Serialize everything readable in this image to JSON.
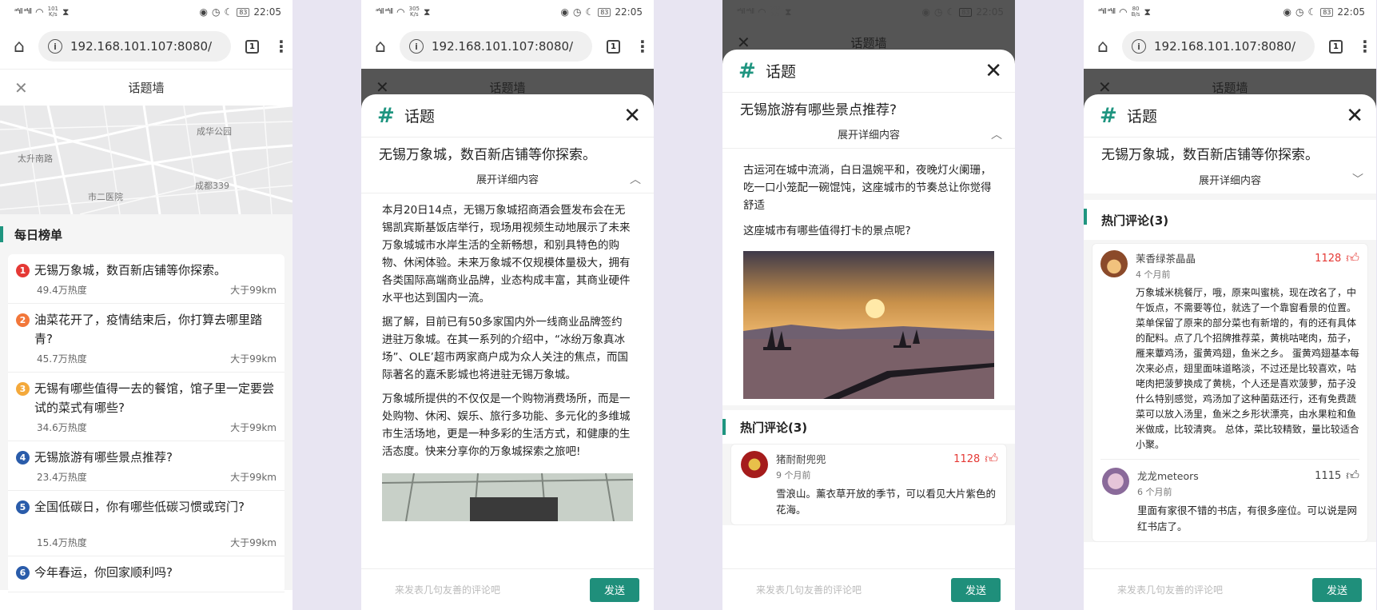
{
  "statusbar": {
    "signal": "ᵃ⁴ıll ᵃ⁴ıll",
    "time": "22:05",
    "battery": "83",
    "speeds": [
      "101\nK/s",
      "305\nK/s",
      "282\nK/s",
      "80\nB/s"
    ]
  },
  "browser": {
    "url": "192.168.101.107:8080/",
    "tab_count": "1"
  },
  "page_title": "话题墙",
  "map": {
    "labels": [
      "成华公园",
      "太升南路",
      "成都339",
      "市二医院"
    ]
  },
  "daily": {
    "title": "每日榜单",
    "items": [
      {
        "num": "1",
        "color": "#e53935",
        "title": "无锡万象城，数百新店铺等你探索。",
        "heat": "49.4万热度",
        "dist": "大于99km"
      },
      {
        "num": "2",
        "color": "#f2773a",
        "title": "油菜花开了，疫情结束后，你打算去哪里踏青?",
        "heat": "45.7万热度",
        "dist": "大于99km"
      },
      {
        "num": "3",
        "color": "#f4a93b",
        "title": "无锡有哪些值得一去的餐馆，馆子里一定要尝试的菜式有哪些?",
        "heat": "34.6万热度",
        "dist": "大于99km"
      },
      {
        "num": "4",
        "color": "#2a5caa",
        "title": "无锡旅游有哪些景点推荐?",
        "heat": "23.4万热度",
        "dist": "大于99km"
      },
      {
        "num": "5",
        "color": "#2a5caa",
        "title": "全国低碳日，你有哪些低碳习惯或窍门?",
        "heat": "15.4万热度",
        "dist": "大于99km"
      },
      {
        "num": "6",
        "color": "#2a5caa",
        "title": "今年春运，你回家顺利吗?",
        "heat": "",
        "dist": ""
      }
    ]
  },
  "sheet": {
    "title": "话题",
    "expand_label": "展开详细内容",
    "topic1": "无锡万象城，数百新店铺等你探索。",
    "topic2": "无锡旅游有哪些景点推荐?",
    "detail1": [
      "本月20日14点，无锡万象城招商酒会暨发布会在无锡凯宾斯基饭店举行，现场用视频生动地展示了未来万象城城市水岸生活的全新畅想，和别具特色的购物、休闲体验。未来万象城不仅规模体量极大，拥有各类国际高端商业品牌，业态构成丰富，其商业硬件水平也达到国内一流。",
      "据了解，目前已有50多家国内外一线商业品牌签约进驻万象城。在其一系列的介绍中，“冰纷万象真冰场”、OLE’超市两家商户成为众人关注的焦点，而国际著名的嘉禾影城也将进驻无锡万象城。",
      "万象城所提供的不仅仅是一个购物消费场所，而是一处购物、休闲、娱乐、旅行多功能、多元化的多维城市生活场地，更是一种多彩的生活方式，和健康的生活态度。快来分享你的万象城探索之旅吧!"
    ],
    "detail2": [
      "古运河在城中流淌，白日温婉平和，夜晚灯火阑珊，吃一口小笼配一碗馄饨，这座城市的节奏总让你觉得舒适",
      "这座城市有哪些值得打卡的景点呢?"
    ],
    "comments_title": "热门评论(3)",
    "comments": [
      {
        "name": "猪耐耐兜兜",
        "time": "9 个月前",
        "likes": "1128",
        "text": "雪浪山。薰衣草开放的季节，可以看见大片紫色的花海。"
      },
      {
        "name": "茉香绿茶晶晶",
        "time": "4 个月前",
        "likes": "1128",
        "text": "万象城米桃餐厅，哦，原来叫蜜桃，现在改名了，中午饭点，不需要等位，就选了一个靠窗看景的位置。菜单保留了原来的部分菜也有新增的，有的还有具体的配料。点了几个招牌推荐菜，黄桃咕咾肉，茄子，雁来蕈鸡汤，蛋黄鸡翅，鱼米之乡。 蛋黄鸡翅基本每次来必点，翅里面味道略淡，不过还是比较喜欢，咕咾肉把菠萝换成了黄桃，个人还是喜欢菠萝，茄子没什么特别感觉，鸡汤加了这种菌菇还行，还有免费蔬菜可以放入汤里，鱼米之乡形状漂亮，由水果粒和鱼米做成，比较清爽。 总体，菜比较精致，量比较适合小聚。"
      },
      {
        "name": "龙龙meteors",
        "time": "6 个月前",
        "likes": "1115",
        "text": "里面有家很不错的书店，有很多座位。可以说是网红书店了。"
      }
    ]
  },
  "footer": {
    "placeholder": "来发表几句友善的评论吧",
    "send": "发送"
  },
  "colors": {
    "accent": "#1f9580",
    "like_red": "#e53935"
  }
}
